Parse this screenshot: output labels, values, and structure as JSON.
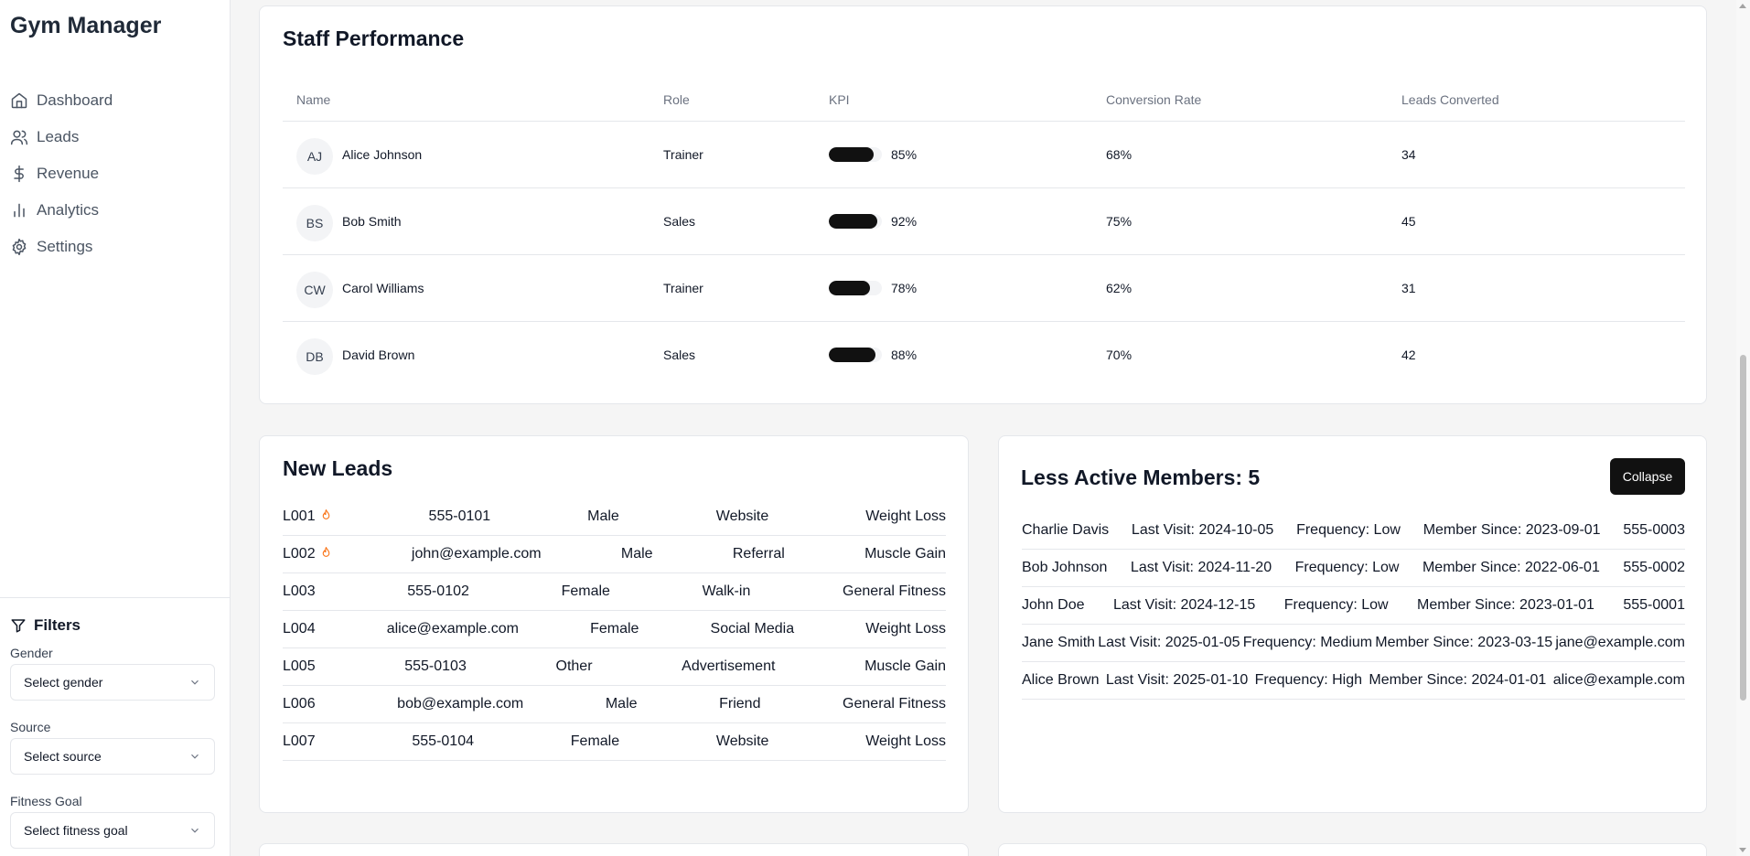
{
  "app": {
    "title": "Gym Manager"
  },
  "nav": [
    {
      "label": "Dashboard",
      "icon": "home-icon"
    },
    {
      "label": "Leads",
      "icon": "users-icon"
    },
    {
      "label": "Revenue",
      "icon": "dollar-icon"
    },
    {
      "label": "Analytics",
      "icon": "bar-chart-icon"
    },
    {
      "label": "Settings",
      "icon": "gear-icon"
    }
  ],
  "filters": {
    "title": "Filters",
    "gender": {
      "label": "Gender",
      "placeholder": "Select gender"
    },
    "source": {
      "label": "Source",
      "placeholder": "Select source"
    },
    "goal": {
      "label": "Fitness Goal",
      "placeholder": "Select fitness goal"
    }
  },
  "staff": {
    "title": "Staff Performance",
    "headers": {
      "name": "Name",
      "role": "Role",
      "kpi": "KPI",
      "conversion": "Conversion Rate",
      "leads": "Leads Converted"
    },
    "rows": [
      {
        "initials": "AJ",
        "name": "Alice Johnson",
        "role": "Trainer",
        "kpi": 85,
        "kpi_label": "85%",
        "conversion": "68%",
        "leads": "34"
      },
      {
        "initials": "BS",
        "name": "Bob Smith",
        "role": "Sales",
        "kpi": 92,
        "kpi_label": "92%",
        "conversion": "75%",
        "leads": "45"
      },
      {
        "initials": "CW",
        "name": "Carol Williams",
        "role": "Trainer",
        "kpi": 78,
        "kpi_label": "78%",
        "conversion": "62%",
        "leads": "31"
      },
      {
        "initials": "DB",
        "name": "David Brown",
        "role": "Sales",
        "kpi": 88,
        "kpi_label": "88%",
        "conversion": "70%",
        "leads": "42"
      }
    ]
  },
  "leads": {
    "title": "New Leads",
    "rows": [
      {
        "id": "L001",
        "hot": true,
        "contact": "555-0101",
        "gender": "Male",
        "source": "Website",
        "goal": "Weight Loss"
      },
      {
        "id": "L002",
        "hot": true,
        "contact": "john@example.com",
        "gender": "Male",
        "source": "Referral",
        "goal": "Muscle Gain"
      },
      {
        "id": "L003",
        "hot": false,
        "contact": "555-0102",
        "gender": "Female",
        "source": "Walk-in",
        "goal": "General Fitness"
      },
      {
        "id": "L004",
        "hot": false,
        "contact": "alice@example.com",
        "gender": "Female",
        "source": "Social Media",
        "goal": "Weight Loss"
      },
      {
        "id": "L005",
        "hot": false,
        "contact": "555-0103",
        "gender": "Other",
        "source": "Advertisement",
        "goal": "Muscle Gain"
      },
      {
        "id": "L006",
        "hot": false,
        "contact": "bob@example.com",
        "gender": "Male",
        "source": "Friend",
        "goal": "General Fitness"
      },
      {
        "id": "L007",
        "hot": false,
        "contact": "555-0104",
        "gender": "Female",
        "source": "Website",
        "goal": "Weight Loss"
      }
    ]
  },
  "members": {
    "title": "Less Active Members: 5",
    "collapse_label": "Collapse",
    "rows": [
      {
        "name": "Charlie Davis",
        "last_visit": "Last Visit: 2024-10-05",
        "frequency": "Frequency: Low",
        "since": "Member Since: 2023-09-01",
        "contact": "555-0003"
      },
      {
        "name": "Bob Johnson",
        "last_visit": "Last Visit: 2024-11-20",
        "frequency": "Frequency: Low",
        "since": "Member Since: 2022-06-01",
        "contact": "555-0002"
      },
      {
        "name": "John Doe",
        "last_visit": "Last Visit: 2024-12-15",
        "frequency": "Frequency: Low",
        "since": "Member Since: 2023-01-01",
        "contact": "555-0001"
      },
      {
        "name": "Jane Smith",
        "last_visit": "Last Visit: 2025-01-05",
        "frequency": "Frequency: Medium",
        "since": "Member Since: 2023-03-15",
        "contact": "jane@example.com"
      },
      {
        "name": "Alice Brown",
        "last_visit": "Last Visit: 2025-01-10",
        "frequency": "Frequency: High",
        "since": "Member Since: 2024-01-01",
        "contact": "alice@example.com"
      }
    ]
  }
}
